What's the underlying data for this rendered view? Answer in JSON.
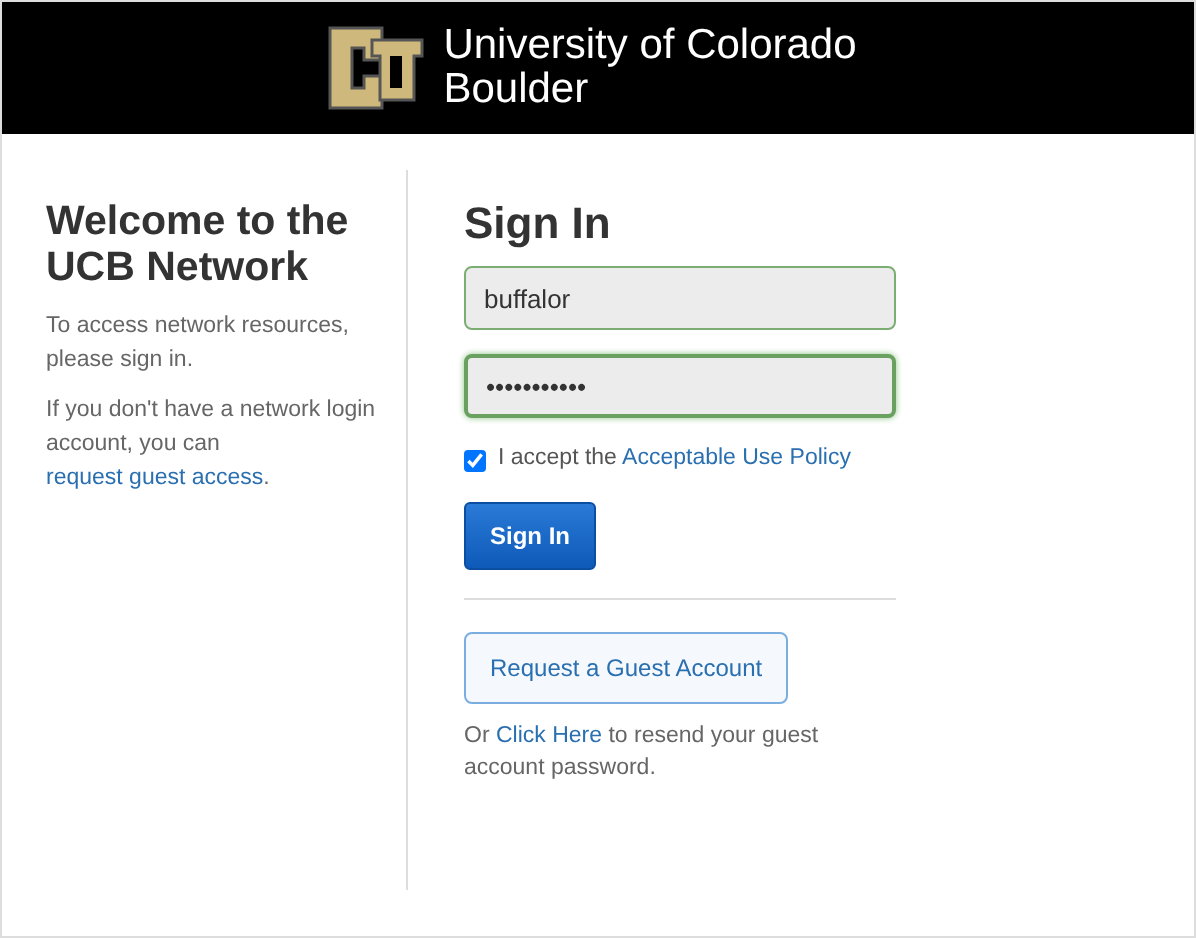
{
  "header": {
    "title_line_1": "University of Colorado",
    "title_line_2": "Boulder"
  },
  "welcome": {
    "heading_line_1": "Welcome to the",
    "heading_line_2": "UCB Network",
    "intro": "To access network resources, please sign in.",
    "guest_text": "If you don't have a network login account, you can",
    "guest_link": "request guest access",
    "guest_end": "."
  },
  "sign_in": {
    "heading": "Sign In",
    "username": {
      "value": "buffalor"
    },
    "password": {
      "value": "•••••••••••",
      "focused": true
    },
    "policy": {
      "checked": true,
      "text": "I accept the",
      "link": "Acceptable Use Policy"
    },
    "button": "Sign In"
  },
  "guest": {
    "button": "Request a Guest Account",
    "prefix": "Or",
    "link": "Click Here",
    "suffix": "to resend your guest account password."
  }
}
